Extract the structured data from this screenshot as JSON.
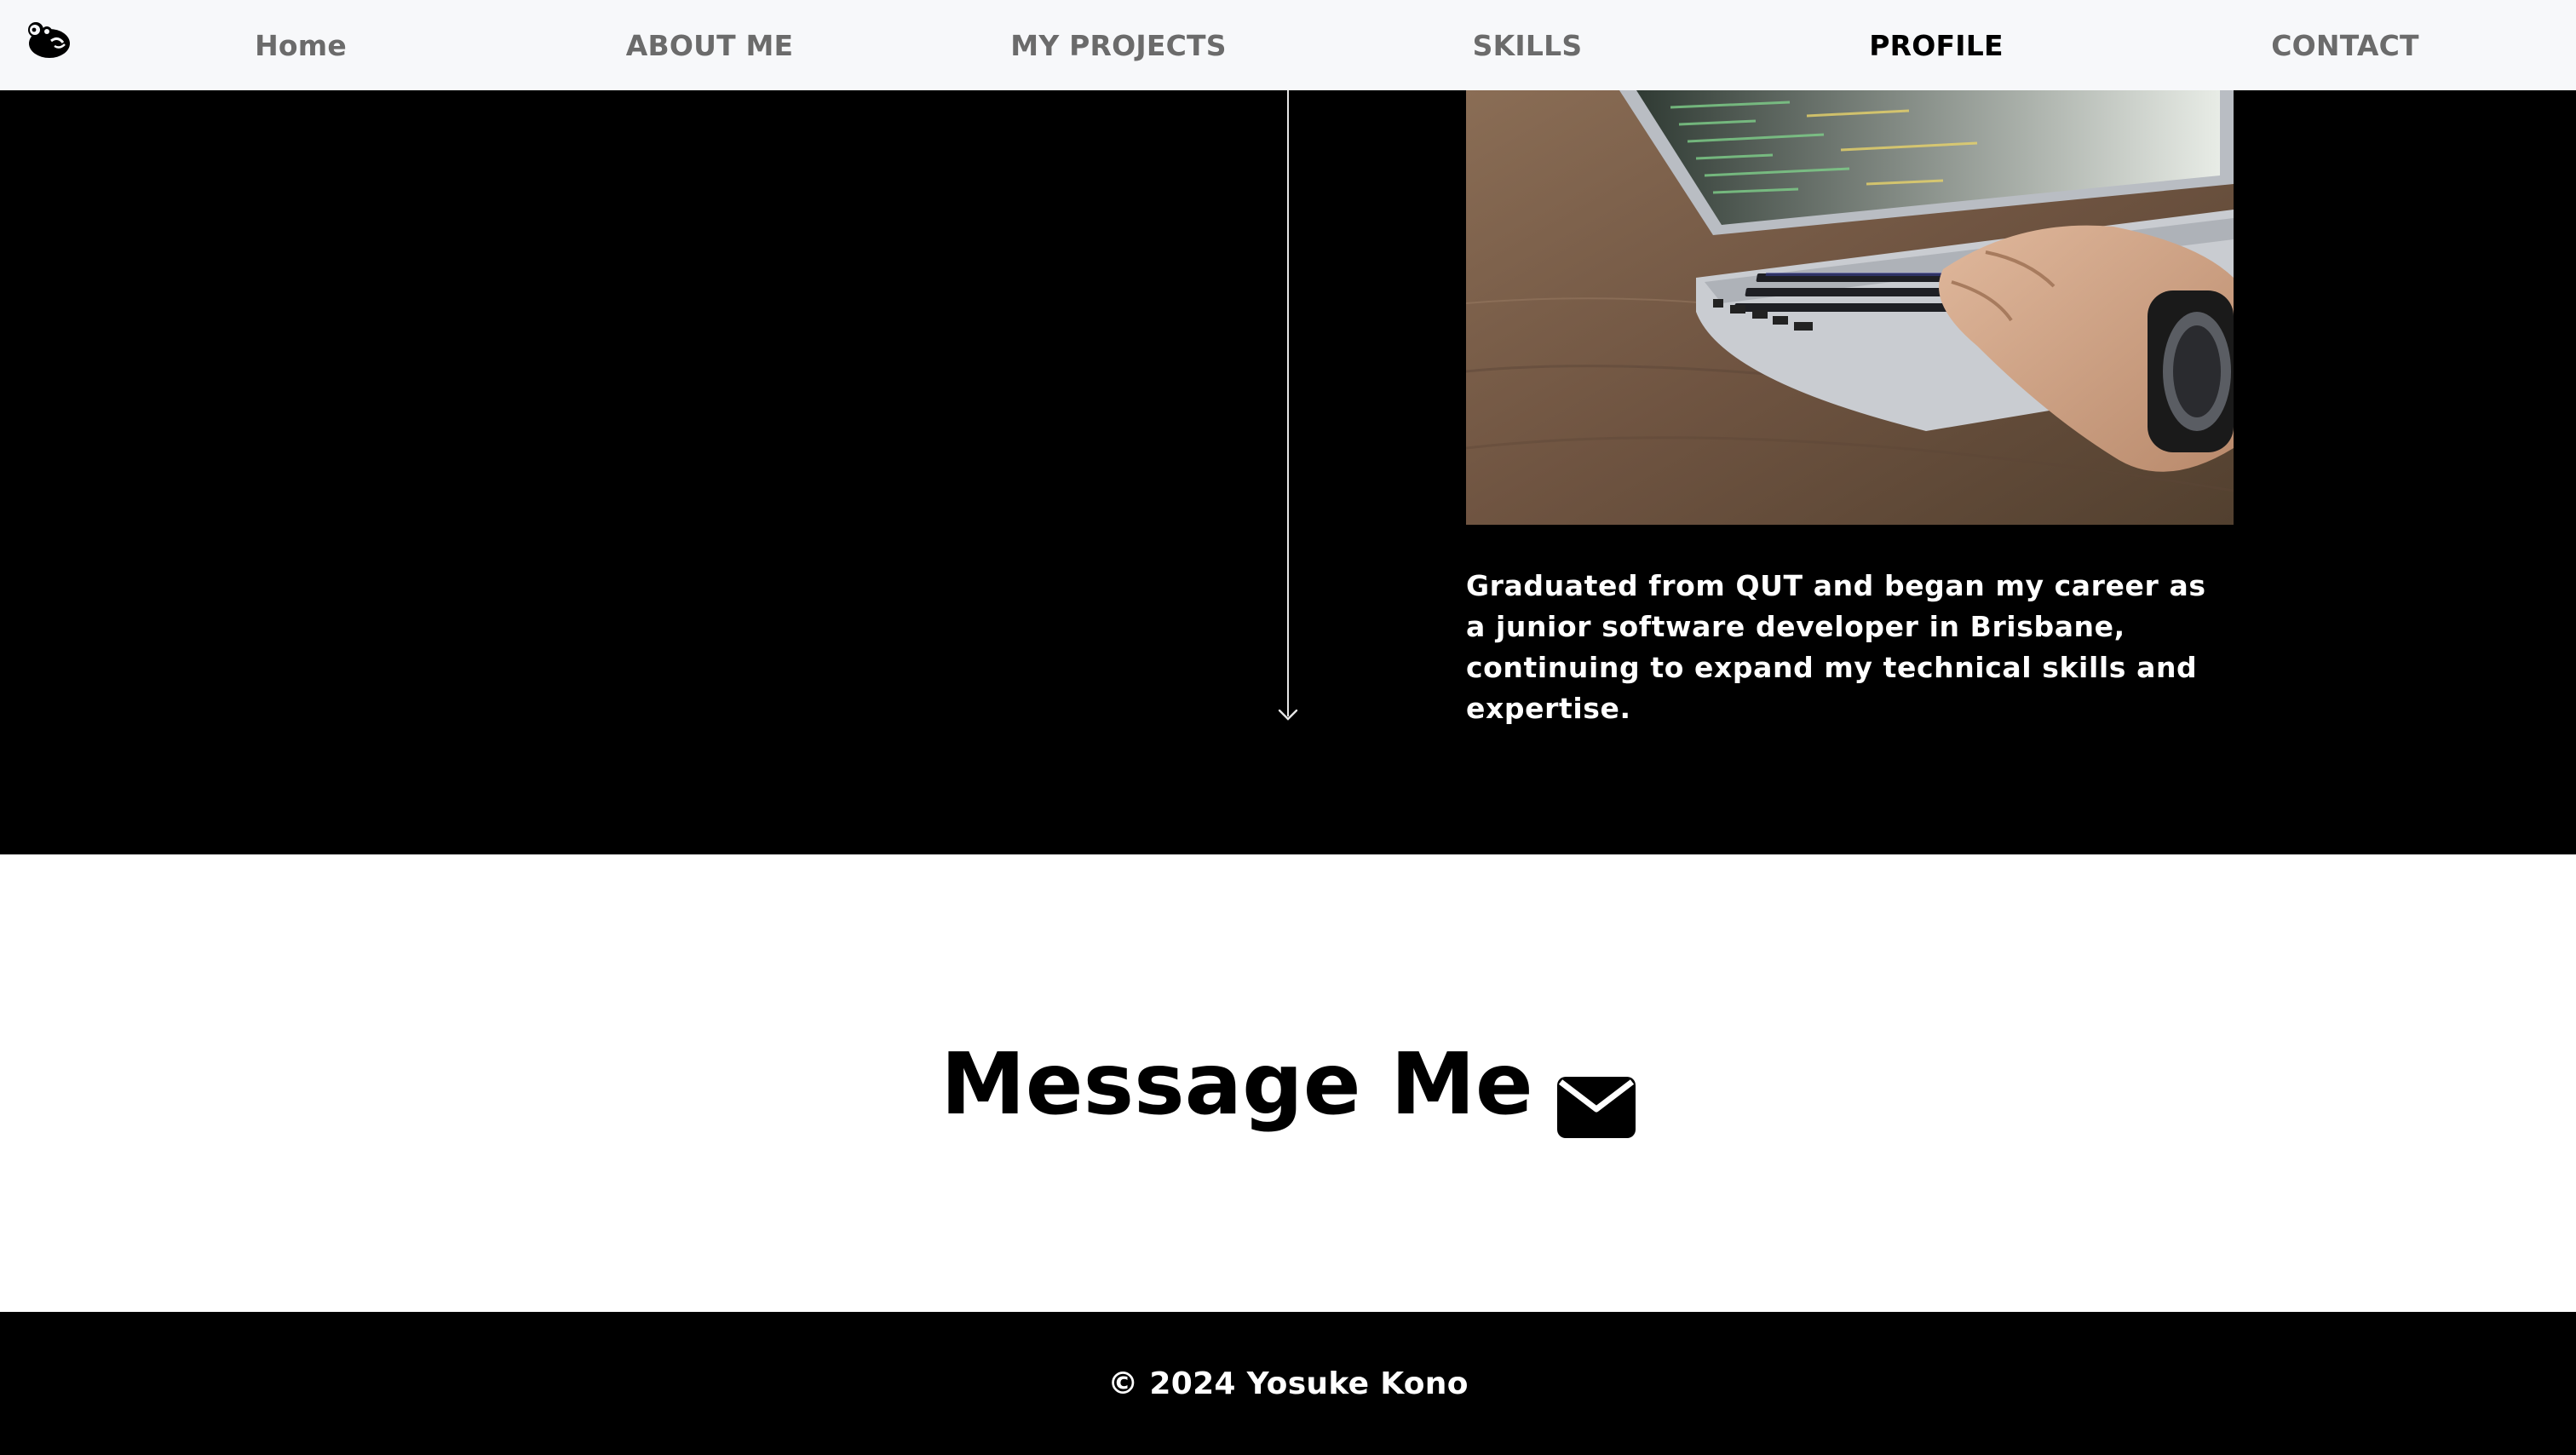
{
  "colors": {
    "nav_bg": "#f7f8fa",
    "nav_text": "#6b6b6b",
    "nav_active": "#000000",
    "section_dark": "#000000",
    "section_light": "#ffffff"
  },
  "nav": {
    "logo_icon": "otter-logo-icon",
    "items": [
      {
        "label": "Home"
      },
      {
        "label": "ABOUT ME"
      },
      {
        "label": "MY PROJECTS"
      },
      {
        "label": "SKILLS"
      },
      {
        "label": "PROFILE",
        "active": true
      },
      {
        "label": "CONTACT"
      }
    ]
  },
  "timeline": {
    "entry": {
      "image": "laptop-coding-photo",
      "text": "Graduated from QUT and began my career as a junior software developer in Brisbane, continuing to expand my technical skills and expertise."
    }
  },
  "message": {
    "heading": "Message Me",
    "icon": "envelope-icon"
  },
  "footer": {
    "copyright": "© 2024 Yosuke Kono"
  }
}
